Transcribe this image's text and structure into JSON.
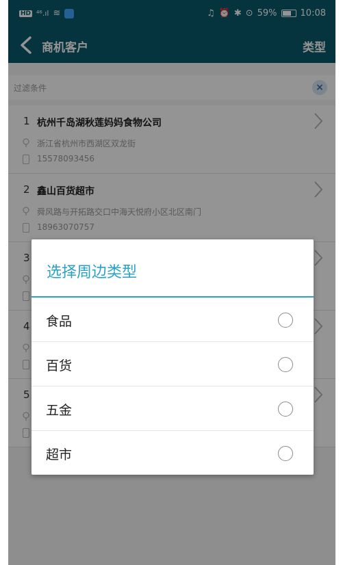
{
  "status_bar": {
    "hd": "HD",
    "signal": "⁴⁶.ıl",
    "battery": "59%",
    "time": "10:08"
  },
  "app_bar": {
    "title": "商机客户",
    "action": "类型"
  },
  "filter": {
    "placeholder": "过滤条件"
  },
  "list": [
    {
      "index": "1",
      "name": "杭州千岛湖秋莲妈妈食物公司",
      "address": "浙江省杭州市西湖区双龙街",
      "phone": "15578093456"
    },
    {
      "index": "2",
      "name": "鑫山百货超市",
      "address": "舜风路与开拓路交口中海天悦府小区北区南门",
      "phone": "18963070757"
    },
    {
      "index": "3",
      "name": "",
      "address": "",
      "phone": ""
    },
    {
      "index": "4",
      "name": "",
      "address": "",
      "phone": ""
    },
    {
      "index": "5",
      "name": "",
      "address": "",
      "phone": ""
    }
  ],
  "dialog": {
    "title": "选择周边类型",
    "options": [
      {
        "label": "食品"
      },
      {
        "label": "百货"
      },
      {
        "label": "五金"
      },
      {
        "label": "超市"
      }
    ]
  },
  "colors": {
    "bar": "#0b5a6b",
    "accent": "#2aa1c9"
  }
}
